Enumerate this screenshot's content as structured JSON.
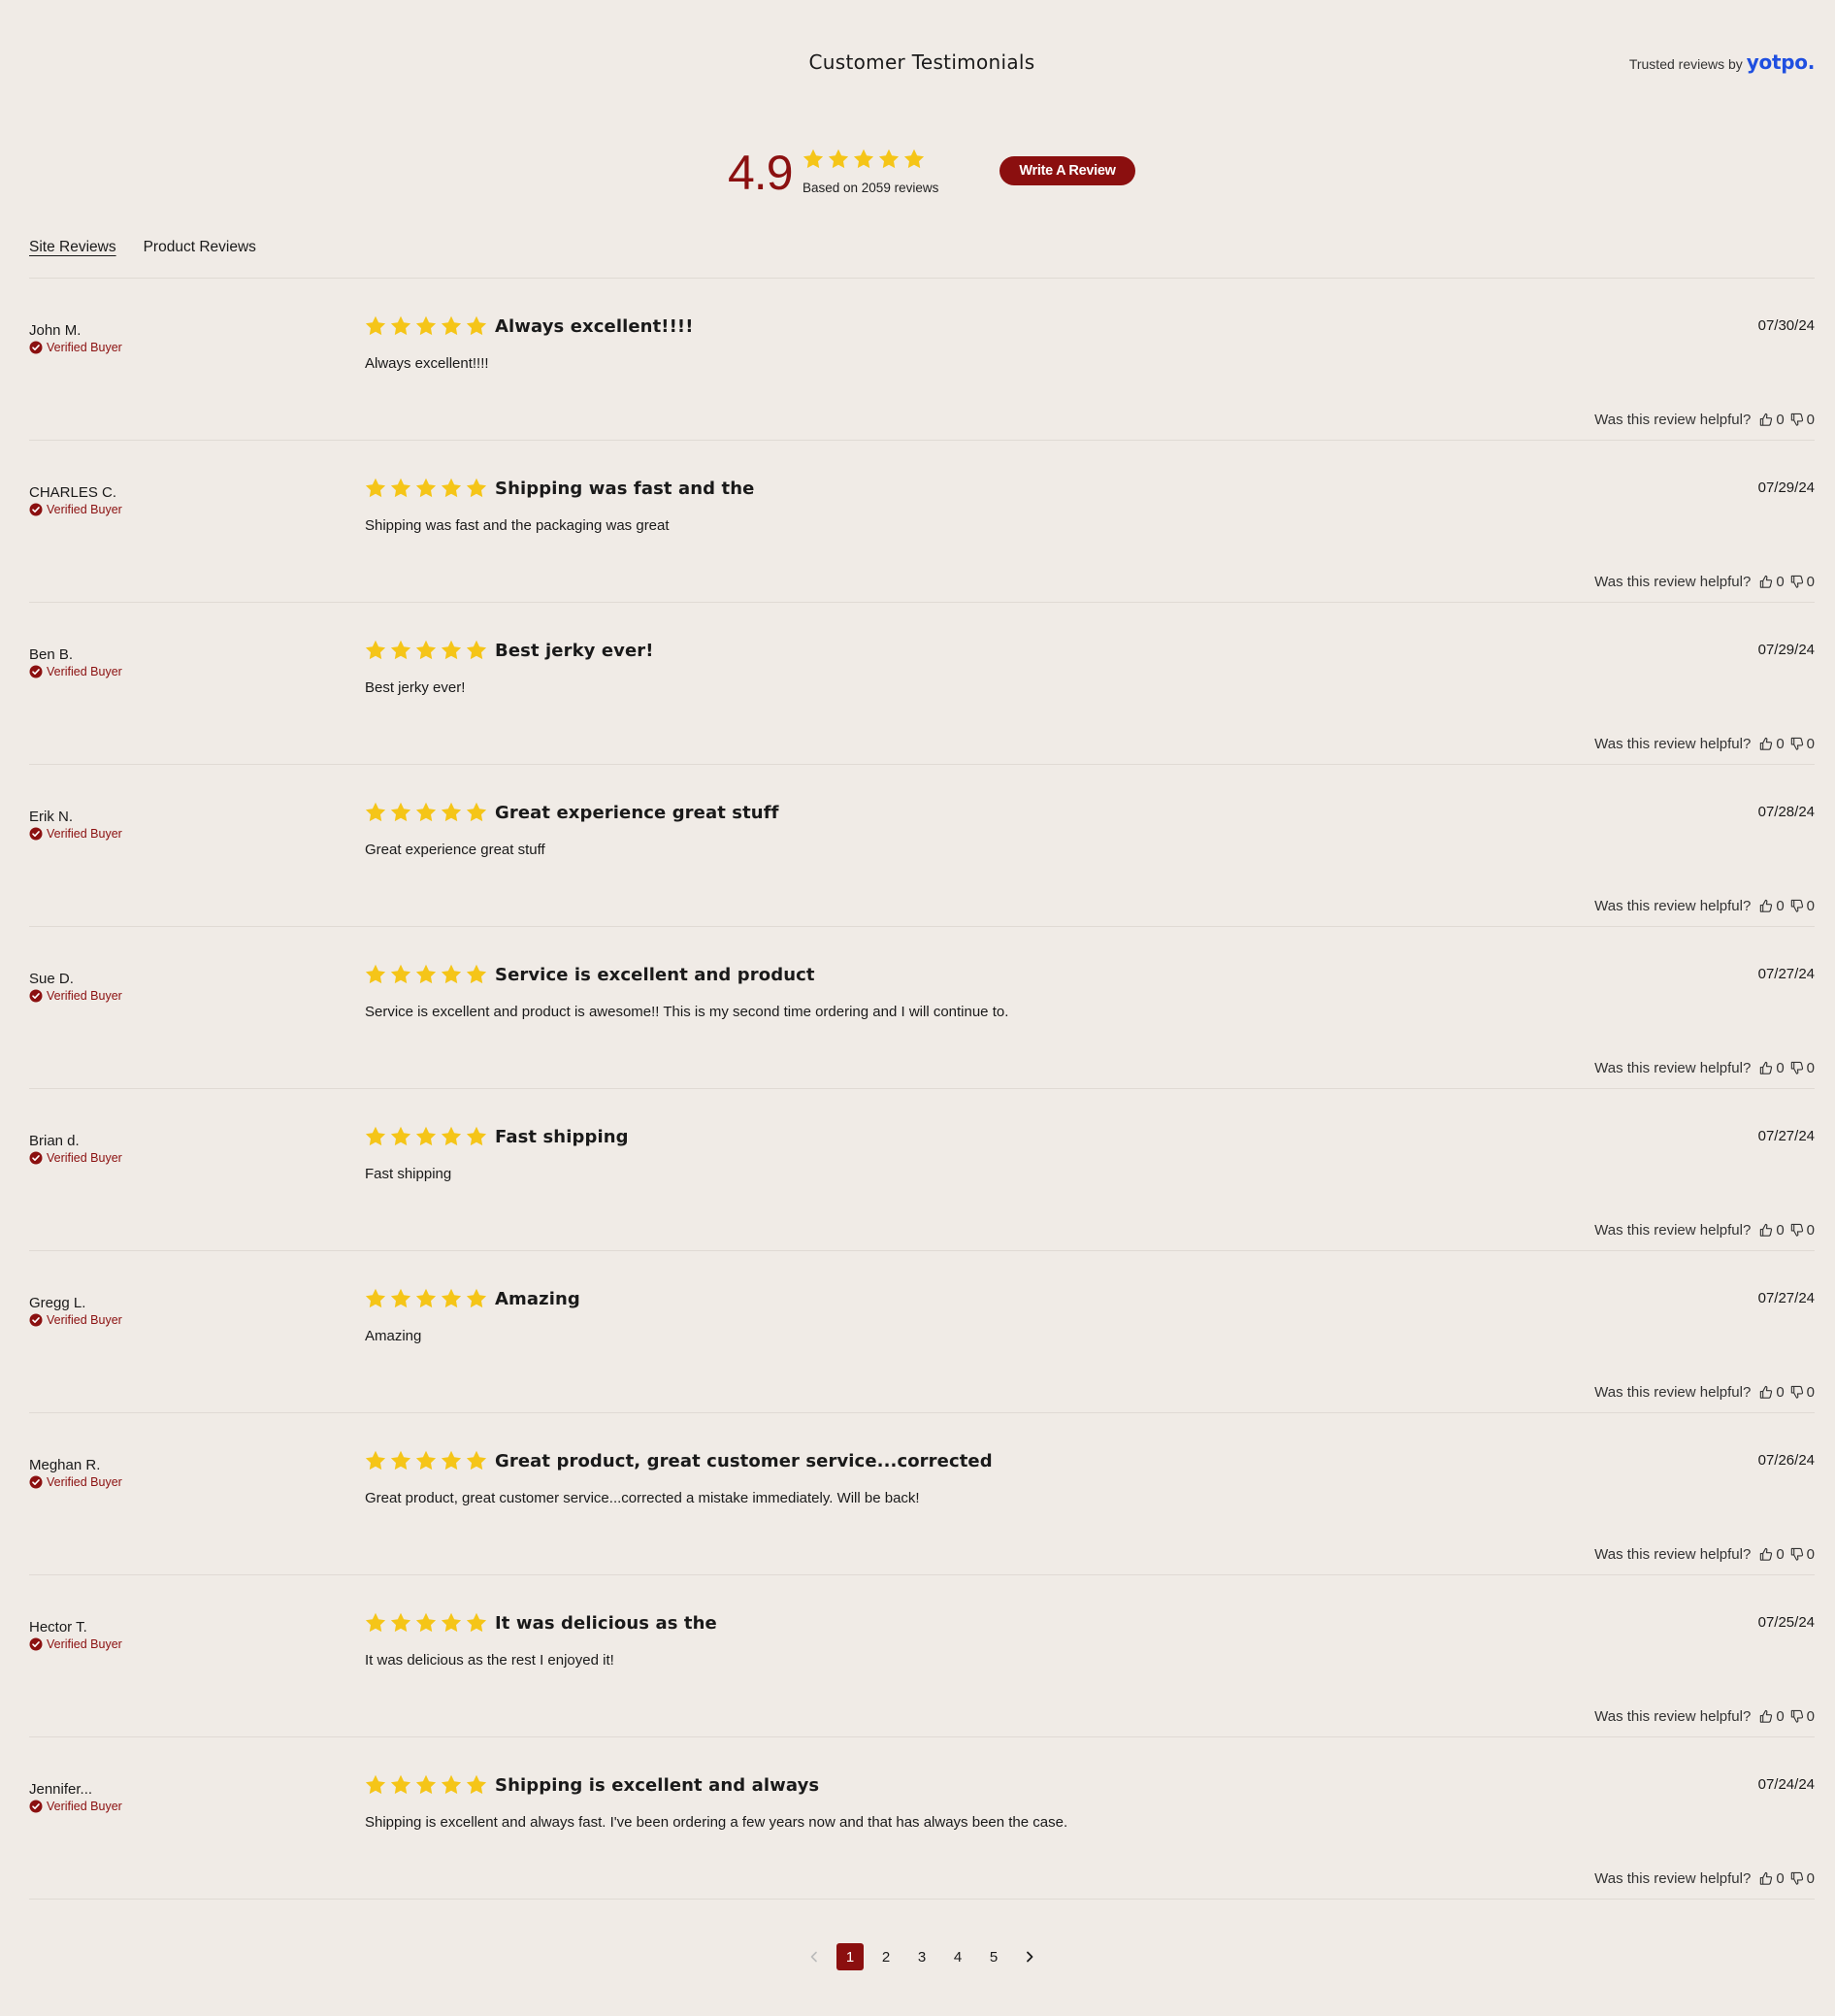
{
  "header": {
    "title": "Customer Testimonials",
    "trusted_text": "Trusted reviews by",
    "brand": "yotpo."
  },
  "summary": {
    "average": "4.9",
    "stars": 5,
    "based_on": "Based on 2059 reviews",
    "write_review_label": "Write A Review"
  },
  "tabs": [
    {
      "label": "Site Reviews",
      "active": true
    },
    {
      "label": "Product Reviews",
      "active": false
    }
  ],
  "colors": {
    "accent": "#8b0f0f",
    "star": "#f5c518",
    "background": "#f0ebe6",
    "brand": "#1f4fe0"
  },
  "icons": {
    "star": "star-icon",
    "verified": "check-circle-icon",
    "thumbs_up": "thumbs-up-icon",
    "thumbs_down": "thumbs-down-icon",
    "prev": "chevron-left-icon",
    "next": "chevron-right-icon"
  },
  "verified_label": "Verified Buyer",
  "helpful_label": "Was this review helpful?",
  "reviews": [
    {
      "author": "John M.",
      "rating": 5,
      "title": "Always excellent!!!!",
      "date": "07/30/24",
      "body": "Always excellent!!!!",
      "up": "0",
      "down": "0"
    },
    {
      "author": "CHARLES C.",
      "rating": 5,
      "title": "Shipping was fast and the",
      "date": "07/29/24",
      "body": "Shipping was fast and the packaging was great",
      "up": "0",
      "down": "0"
    },
    {
      "author": "Ben B.",
      "rating": 5,
      "title": "Best jerky ever!",
      "date": "07/29/24",
      "body": "Best jerky ever!",
      "up": "0",
      "down": "0"
    },
    {
      "author": "Erik N.",
      "rating": 5,
      "title": "Great experience great stuff",
      "date": "07/28/24",
      "body": "Great experience great stuff",
      "up": "0",
      "down": "0"
    },
    {
      "author": "Sue D.",
      "rating": 5,
      "title": "Service is excellent and product",
      "date": "07/27/24",
      "body": "Service is excellent and product is awesome!! This is my second time ordering and I will continue to.",
      "up": "0",
      "down": "0"
    },
    {
      "author": "Brian d.",
      "rating": 5,
      "title": "Fast shipping",
      "date": "07/27/24",
      "body": "Fast shipping",
      "up": "0",
      "down": "0"
    },
    {
      "author": "Gregg L.",
      "rating": 5,
      "title": "Amazing",
      "date": "07/27/24",
      "body": "Amazing",
      "up": "0",
      "down": "0"
    },
    {
      "author": "Meghan R.",
      "rating": 5,
      "title": "Great product, great customer service...corrected",
      "date": "07/26/24",
      "body": "Great product, great customer service...corrected a mistake immediately. Will be back!",
      "up": "0",
      "down": "0"
    },
    {
      "author": "Hector T.",
      "rating": 5,
      "title": "It was delicious as the",
      "date": "07/25/24",
      "body": "It was delicious as the rest I enjoyed it!",
      "up": "0",
      "down": "0"
    },
    {
      "author": "Jennifer...",
      "rating": 5,
      "title": "Shipping is excellent and always",
      "date": "07/24/24",
      "body": "Shipping is excellent and always fast. I've been ordering a few years now and that has always been the case.",
      "up": "0",
      "down": "0"
    }
  ],
  "pagination": {
    "pages": [
      "1",
      "2",
      "3",
      "4",
      "5"
    ],
    "current": "1"
  }
}
